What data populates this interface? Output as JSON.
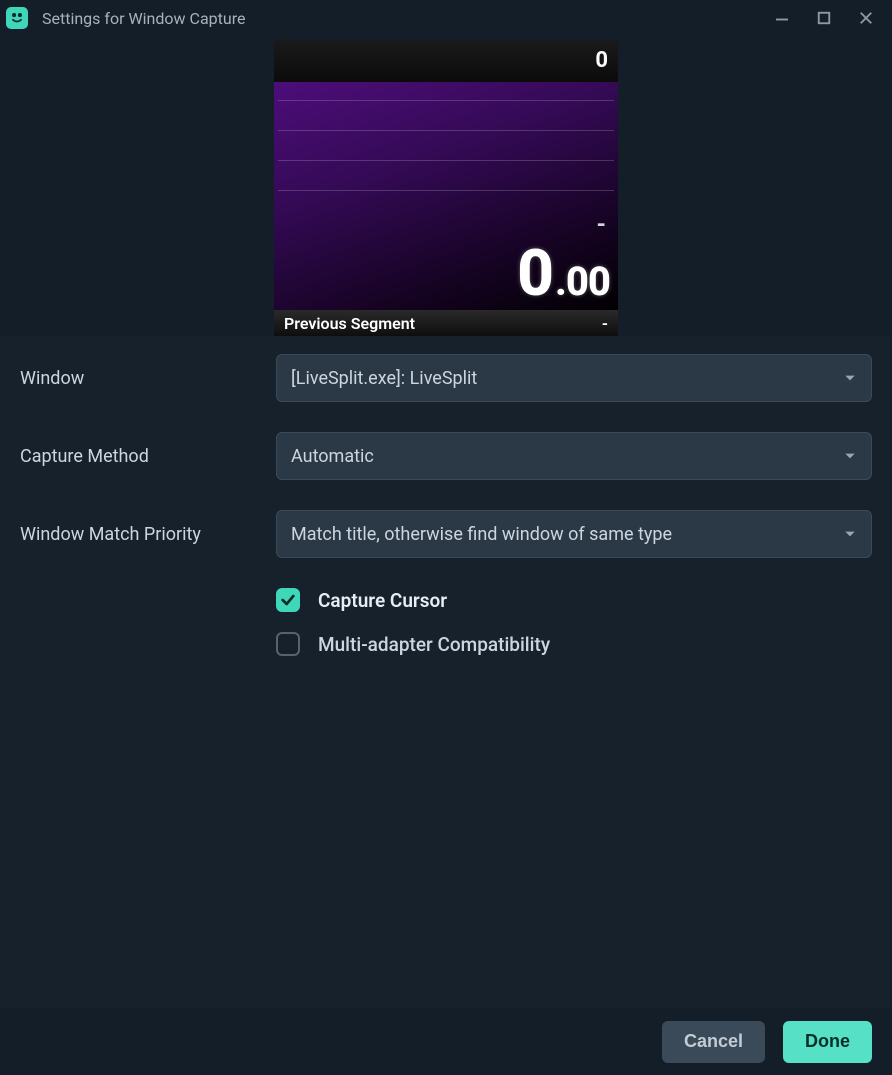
{
  "titlebar": {
    "title": "Settings for Window Capture"
  },
  "preview": {
    "top_value": "0",
    "dash": "-",
    "timer_main": "0",
    "timer_sub": ".00",
    "footer_label": "Previous Segment",
    "footer_value": "-"
  },
  "form": {
    "window": {
      "label": "Window",
      "value": "[LiveSplit.exe]: LiveSplit"
    },
    "capture_method": {
      "label": "Capture Method",
      "value": "Automatic"
    },
    "match_priority": {
      "label": "Window Match Priority",
      "value": "Match title, otherwise find window of same type"
    },
    "capture_cursor": {
      "label": "Capture Cursor",
      "checked": true
    },
    "multi_adapter": {
      "label": "Multi-adapter Compatibility",
      "checked": false
    }
  },
  "buttons": {
    "cancel": "Cancel",
    "done": "Done"
  }
}
